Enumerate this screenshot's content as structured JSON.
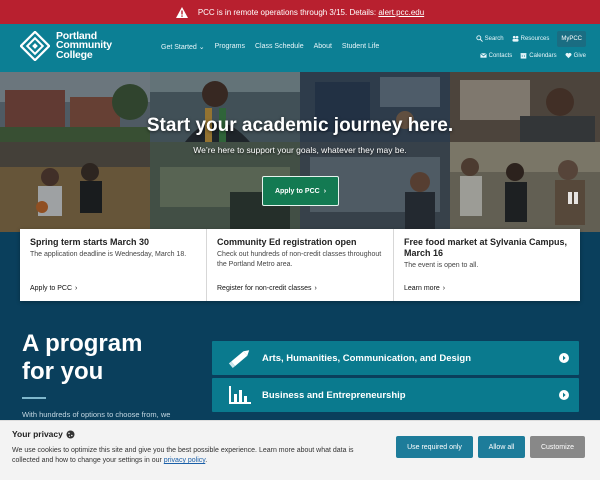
{
  "alert": {
    "text": "PCC is in remote operations through 3/15. Details: ",
    "link": "alert.pcc.edu"
  },
  "header": {
    "logo_line1": "Portland",
    "logo_line2": "Community",
    "logo_line3": "College",
    "nav": [
      "Get Started",
      "Programs",
      "Class Schedule",
      "About",
      "Student Life"
    ],
    "util": {
      "search": "Search",
      "resources": "Resources",
      "mypcc": "MyPCC",
      "contacts": "Contacts",
      "calendars": "Calendars",
      "give": "Give"
    }
  },
  "hero": {
    "title": "Start your academic journey here.",
    "subtitle": "We’re here to support your goals, whatever they may be.",
    "button": "Apply to PCC"
  },
  "cards": [
    {
      "title": "Spring term starts March 30",
      "body": "The application deadline is Wednesday, March 18.",
      "link": "Apply to PCC"
    },
    {
      "title": "Community Ed registration open",
      "body": "Check out hundreds of non-credit classes throughout the Portland Metro area.",
      "link": "Register for non-credit classes"
    },
    {
      "title": "Free food market at Sylvania Campus, March 16",
      "body": "The event is open to all.",
      "link": "Learn more"
    }
  ],
  "programs": {
    "title_line1": "A program",
    "title_line2": "for you",
    "intro": "With hundreds of options to choose from, we",
    "items": [
      {
        "label": "Arts, Humanities, Communication, and Design",
        "icon": "pencil-icon"
      },
      {
        "label": "Business and Entrepreneurship",
        "icon": "bar-chart-icon"
      }
    ]
  },
  "cookie": {
    "title": "Your privacy",
    "text": "We use cookies to optimize this site and give you the best possible experience. Learn more about what data is collected and how to change your settings in our ",
    "link": "privacy policy",
    "text_end": ".",
    "buttons": {
      "required": "Use required only",
      "all": "Allow all",
      "customize": "Customize"
    }
  },
  "colors": {
    "alert_red": "#b8202f",
    "header_teal": "#0c7f94",
    "apply_green": "#137a52",
    "page_navy": "#0a3f5c"
  }
}
